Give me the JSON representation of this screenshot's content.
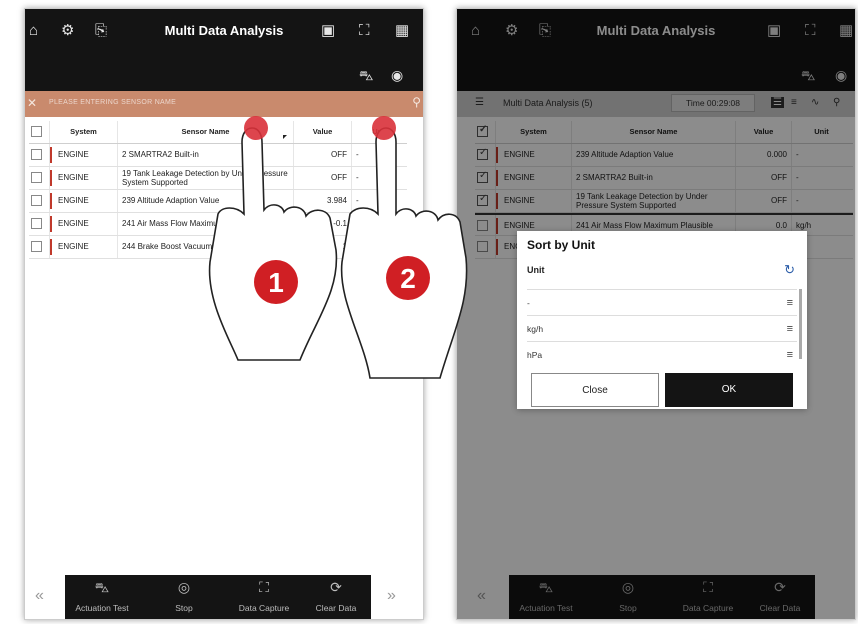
{
  "left": {
    "app_title": "Multi Data Analysis",
    "search_placeholder": "PLEASE ENTERING SENSOR NAME",
    "columns": [
      "System",
      "Sensor Name",
      "Value",
      "Unit"
    ],
    "rows": [
      {
        "system": "ENGINE",
        "sensor": "2 SMARTRA2 Built-in",
        "value": "OFF",
        "unit": "-"
      },
      {
        "system": "ENGINE",
        "sensor": "19 Tank Leakage Detection by Under Pressure System Supported",
        "value": "OFF",
        "unit": "-"
      },
      {
        "system": "ENGINE",
        "sensor": "239 Altitude Adaption Value",
        "value": "3.984",
        "unit": "-"
      },
      {
        "system": "ENGINE",
        "sensor": "241 Air Mass Flow Maximum Plausible",
        "value": "-0.1",
        "unit": "kg/h"
      },
      {
        "system": "ENGINE",
        "sensor": "244 Brake Boost Vacuum",
        "value": "1",
        "unit": ""
      }
    ],
    "bottom": [
      "Actuation Test",
      "Stop",
      "Data Capture",
      "Clear Data"
    ],
    "step_labels": [
      "1",
      "2"
    ]
  },
  "right": {
    "app_title": "Multi Data Analysis",
    "tab_label": "Multi Data Analysis (5)",
    "time_label": "Time 00:29:08",
    "columns": [
      "System",
      "Sensor Name",
      "Value",
      "Unit"
    ],
    "rows": [
      {
        "system": "ENGINE",
        "sensor": "239 Altitude Adaption Value",
        "value": "0.000",
        "unit": "-",
        "checked": true
      },
      {
        "system": "ENGINE",
        "sensor": "2 SMARTRA2 Built-in",
        "value": "OFF",
        "unit": "-",
        "checked": true
      },
      {
        "system": "ENGINE",
        "sensor": "19 Tank Leakage Detection by Under Pressure System Supported",
        "value": "OFF",
        "unit": "-",
        "checked": true
      },
      {
        "system": "ENGINE",
        "sensor": "241 Air Mass Flow Maximum Plausible",
        "value": "0.0",
        "unit": "kg/h",
        "checked": false
      },
      {
        "system": "ENGINE",
        "sensor": "",
        "value": "",
        "unit": "a",
        "checked": false
      }
    ],
    "dialog": {
      "title": "Sort by Unit",
      "header": "Unit",
      "options": [
        "-",
        "kg/h",
        "hPa"
      ],
      "close_label": "Close",
      "ok_label": "OK"
    },
    "bottom": [
      "Actuation Test",
      "Stop",
      "Data Capture",
      "Clear Data"
    ]
  },
  "colors": {
    "topbar": "#141414",
    "search_bar": "#c98a6d",
    "touch_marker": "#d9313a",
    "step_badge": "#d01f24",
    "dim_overlay": "#000000"
  },
  "icons": [
    "home-icon",
    "vehicle-icon",
    "export-icon",
    "screen-icon",
    "fullscreen-icon",
    "grid-icon",
    "car-check-icon",
    "close-icon",
    "search-icon",
    "refresh-icon",
    "drag-handle-icon",
    "chevron-left-icon",
    "chevron-right-icon"
  ]
}
